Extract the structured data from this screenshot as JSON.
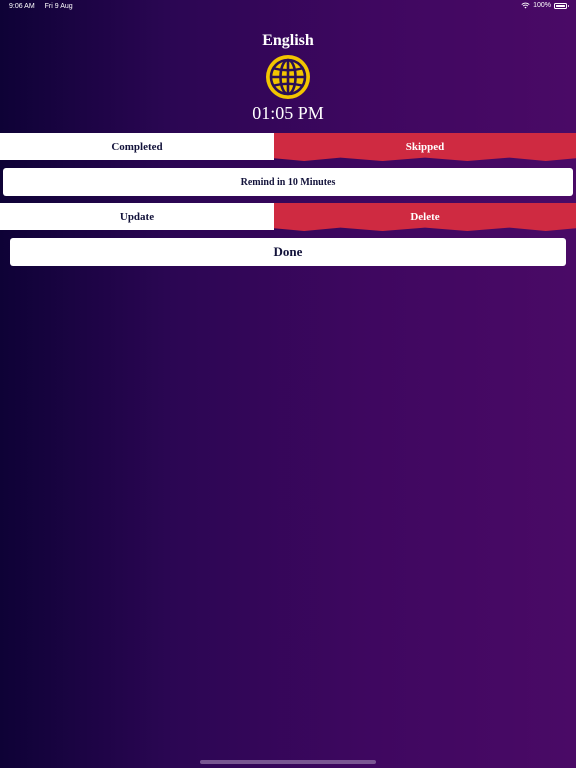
{
  "status_bar": {
    "time": "9:06 AM",
    "date": "Fri 9 Aug",
    "battery": "100%"
  },
  "header": {
    "language": "English",
    "time": "01:05 PM"
  },
  "icons": {
    "globe": "globe-icon",
    "wifi": "wifi-icon",
    "battery": "battery-icon"
  },
  "actions": {
    "completed_label": "Completed",
    "skipped_label": "Skipped",
    "remind_label": "Remind in 10 Minutes",
    "update_label": "Update",
    "delete_label": "Delete",
    "done_label": "Done"
  },
  "colors": {
    "accent_red": "#cf2a41",
    "globe_yellow": "#f2c500",
    "button_white": "#ffffff"
  }
}
